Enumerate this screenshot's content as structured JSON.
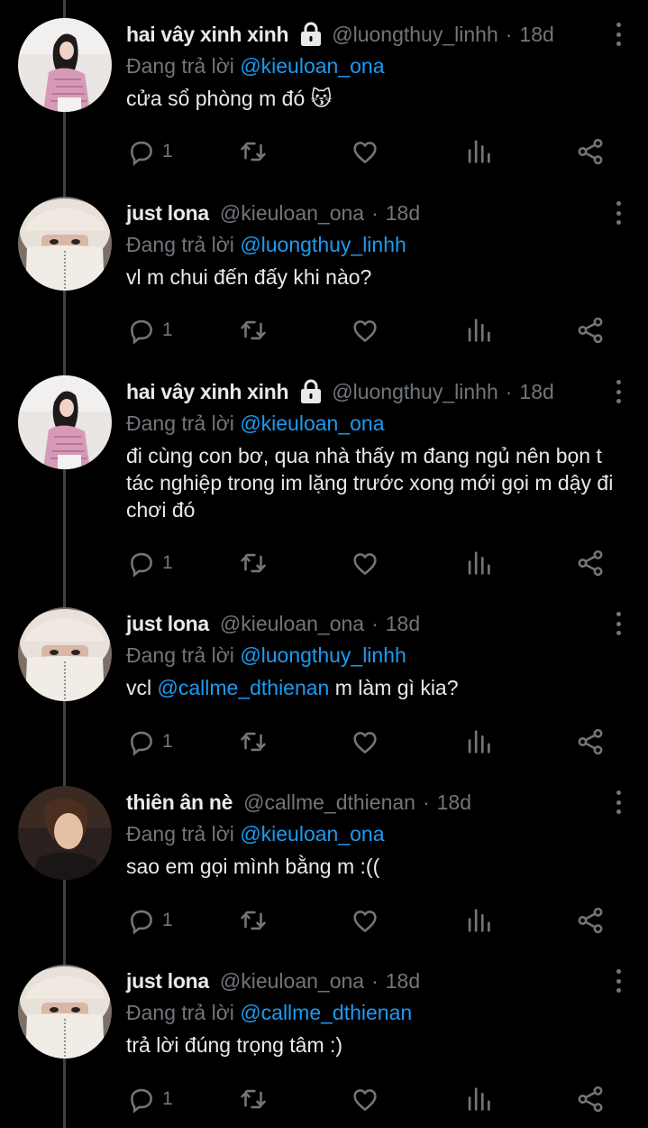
{
  "colors": {
    "background": "#000000",
    "text_primary": "#e7e9ea",
    "text_secondary": "#71767b",
    "mention": "#1d9bf0",
    "thread_line": "#3d4347"
  },
  "icons": {
    "reply": "reply-bubble-icon",
    "retweet": "retweet-icon",
    "like": "heart-icon",
    "views": "analytics-icon",
    "share": "share-icon",
    "more": "more-vertical-icon",
    "protected": "lock-icon"
  },
  "reply_prefix": "Đang trả lời",
  "tweets": [
    {
      "name": "hai vây xinh xinh",
      "protected": true,
      "handle": "@luongthuy_linhh",
      "time": "18d",
      "reply_to": "@kieuloan_ona",
      "text_parts": [
        {
          "t": "cửa sổ phòng m đó 😽",
          "m": false
        }
      ],
      "reply_count": "1",
      "avatar": "girl-pink"
    },
    {
      "name": "just lona",
      "protected": false,
      "handle": "@kieuloan_ona",
      "time": "18d",
      "reply_to": "@luongthuy_linhh",
      "text_parts": [
        {
          "t": "vl m chui đến đấy khi nào?",
          "m": false
        }
      ],
      "reply_count": "1",
      "avatar": "hat-white"
    },
    {
      "name": "hai vây xinh xinh",
      "protected": true,
      "handle": "@luongthuy_linhh",
      "time": "18d",
      "reply_to": "@kieuloan_ona",
      "text_parts": [
        {
          "t": "đi cùng con bơ, qua nhà thấy m đang ngủ nên bọn t tác nghiệp trong im lặng trước xong mới gọi m dậy đi chơi đó",
          "m": false
        }
      ],
      "reply_count": "1",
      "avatar": "girl-pink"
    },
    {
      "name": "just lona",
      "protected": false,
      "handle": "@kieuloan_ona",
      "time": "18d",
      "reply_to": "@luongthuy_linhh",
      "text_parts": [
        {
          "t": "vcl ",
          "m": false
        },
        {
          "t": "@callme_dthienan",
          "m": true
        },
        {
          "t": " m làm gì kia?",
          "m": false
        }
      ],
      "reply_count": "1",
      "avatar": "hat-white"
    },
    {
      "name": "thiên ân nè",
      "protected": false,
      "handle": "@callme_dthienan",
      "time": "18d",
      "reply_to": "@kieuloan_ona",
      "text_parts": [
        {
          "t": "sao em gọi mình bằng m :((",
          "m": false
        }
      ],
      "reply_count": "1",
      "avatar": "dark-face"
    },
    {
      "name": "just lona",
      "protected": false,
      "handle": "@kieuloan_ona",
      "time": "18d",
      "reply_to": "@callme_dthienan",
      "text_parts": [
        {
          "t": "trả lời đúng trọng tâm :)",
          "m": false
        }
      ],
      "reply_count": "1",
      "avatar": "hat-white"
    }
  ]
}
